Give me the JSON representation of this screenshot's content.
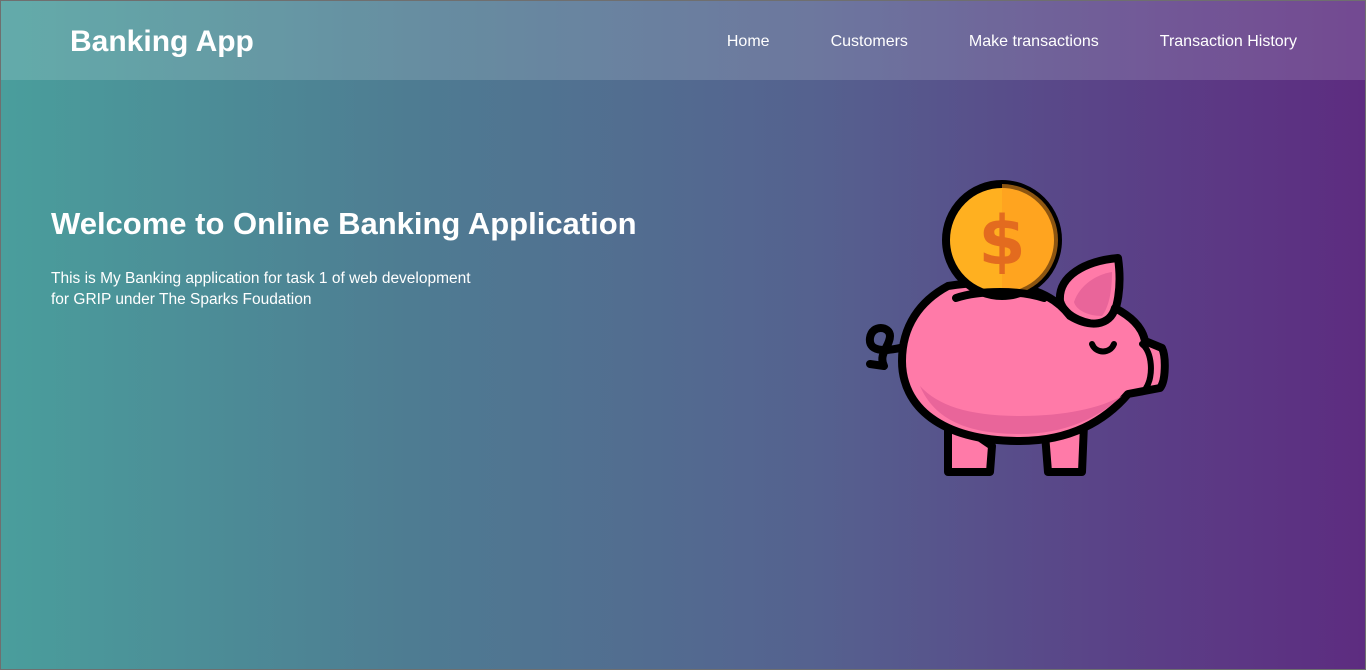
{
  "navbar": {
    "brand": "Banking App",
    "links": [
      "Home",
      "Customers",
      "Make transactions",
      "Transaction History"
    ]
  },
  "hero": {
    "title": "Welcome to Online Banking Application",
    "description_lines": [
      "This is My Banking application for task 1 of web development",
      "for GRIP under The Sparks Foudation"
    ]
  },
  "illustration": {
    "icon": "piggy-bank-icon",
    "coin_symbol": "$"
  },
  "colors": {
    "gradient_start": "#4a9e9c",
    "gradient_end": "#5d2c80",
    "pig": "#ff7aa8",
    "pig_shadow": "#e9659a",
    "coin": "#ffb020",
    "coin_shade": "#ff9a1f",
    "coin_symbol": "#e36b1f",
    "outline": "#000000"
  }
}
